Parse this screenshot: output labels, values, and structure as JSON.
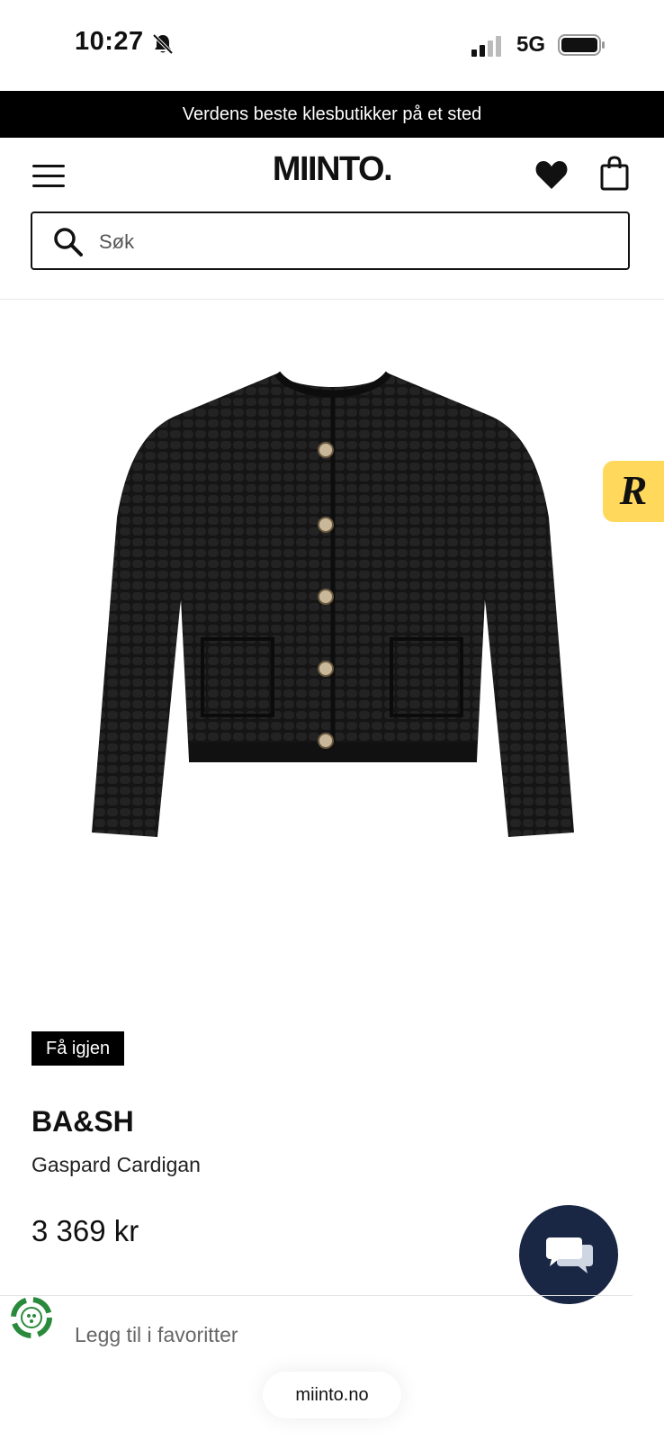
{
  "status_bar": {
    "time": "10:27",
    "network": "5G",
    "bell_icon": "bell-slash-icon",
    "signal_icon": "signal-bars-icon",
    "battery_icon": "battery-icon"
  },
  "promo": {
    "text": "Verdens beste klesbutikker på et sted"
  },
  "header": {
    "logo": "MIINTO.",
    "menu_icon": "hamburger-menu-icon",
    "favorites_icon": "heart-icon",
    "cart_icon": "shopping-bag-icon"
  },
  "search": {
    "placeholder": "Søk",
    "value": ""
  },
  "product": {
    "image": "black-knit-cardigan",
    "tag": "Få igjen",
    "brand": "BA&SH",
    "name": "Gaspard Cardigan",
    "price": "3 369 kr",
    "favorite_label": "Legg til i favoritter"
  },
  "widgets": {
    "r_badge": "R",
    "chat_icon": "chat-bubbles-icon",
    "eco_icon": "eco-badge-icon"
  },
  "browser": {
    "url": "miinto.no"
  },
  "colors": {
    "promo_bg": "#000000",
    "chat_bg": "#1a2744",
    "badge_yellow": "#ffd85c",
    "eco_green": "#2a8a3c"
  }
}
